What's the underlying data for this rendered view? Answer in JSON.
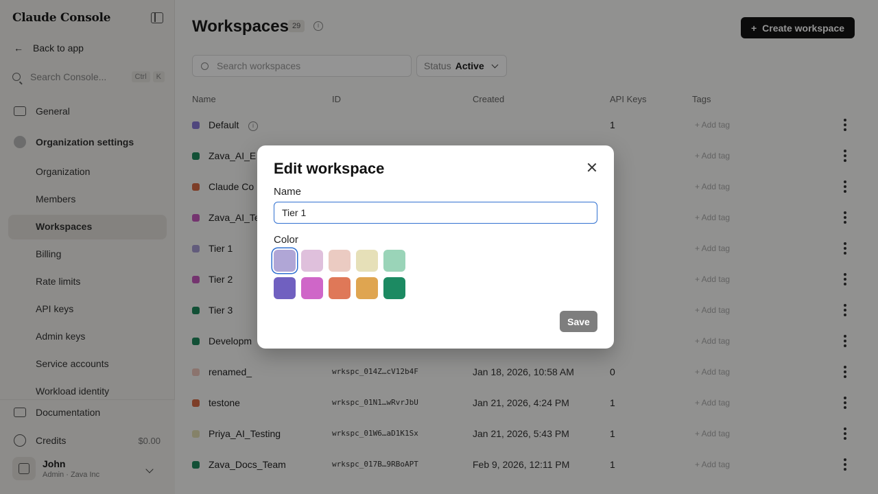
{
  "sidebar": {
    "logo": "Claude Console",
    "back": "Back to app",
    "search": {
      "placeholder": "Search Console...",
      "kbd1": "Ctrl",
      "kbd2": "K"
    },
    "general": "General",
    "org_settings": "Organization settings",
    "items": [
      "Organization",
      "Members",
      "Workspaces",
      "Billing",
      "Rate limits",
      "API keys",
      "Admin keys",
      "Service accounts",
      "Workload identity"
    ],
    "documentation": "Documentation",
    "credits": "Credits",
    "credits_value": "$0.00",
    "user": {
      "name": "John",
      "sub": "Admin · Zava Inc"
    }
  },
  "main": {
    "title": "Workspaces",
    "count": "29",
    "create_button": "Create workspace",
    "search_placeholder": "Search workspaces",
    "status_label": "Status",
    "status_value": "Active",
    "columns": [
      "Name",
      "ID",
      "Created",
      "API Keys",
      "Tags"
    ],
    "add_tag": "+ Add tag",
    "rows": [
      {
        "name": "Default",
        "id": "",
        "created": "",
        "keys": "1",
        "color": "#8a7ad8"
      },
      {
        "name": "Zava_AI_E",
        "id": "",
        "created": "",
        "keys": "",
        "color": "#1f8a5e"
      },
      {
        "name": "Claude Co",
        "id": "",
        "created": "",
        "keys": "",
        "color": "#d86b45"
      },
      {
        "name": "Zava_AI_Te",
        "id": "",
        "created": "",
        "keys": "",
        "color": "#c95bbf"
      },
      {
        "name": "Tier 1",
        "id": "",
        "created": "",
        "keys": "",
        "color": "#a99fd6"
      },
      {
        "name": "Tier 2",
        "id": "",
        "created": "",
        "keys": "",
        "color": "#c95bbf"
      },
      {
        "name": "Tier 3",
        "id": "",
        "created": "",
        "keys": "",
        "color": "#1f8a5e"
      },
      {
        "name": "Developm",
        "id": "",
        "created": "",
        "keys": "",
        "color": "#1f8a5e"
      },
      {
        "name": "renamed_",
        "id": "wrkspc_014Z…cV12b4F",
        "created": "Jan 18, 2026, 10:58 AM",
        "keys": "0",
        "color": "#f0c9bd"
      },
      {
        "name": "testone",
        "id": "wrkspc_01N1…wRvrJbU",
        "created": "Jan 21, 2026, 4:24 PM",
        "keys": "1",
        "color": "#d86b45"
      },
      {
        "name": "Priya_AI_Testing",
        "id": "wrkspc_01W6…aD1K1Sx",
        "created": "Jan 21, 2026, 5:43 PM",
        "keys": "1",
        "color": "#e5e0b6"
      },
      {
        "name": "Zava_Docs_Team",
        "id": "wrkspc_017B…9RBoAPT",
        "created": "Feb 9, 2026, 12:11 PM",
        "keys": "1",
        "color": "#1f8a5e"
      }
    ]
  },
  "modal": {
    "title": "Edit workspace",
    "name_label": "Name",
    "name_value": "Tier 1",
    "color_label": "Color",
    "colors": [
      "#b0a6d6",
      "#dfc0dc",
      "#ebcbc2",
      "#e6e0b8",
      "#9ad4b8",
      "#7060c0",
      "#cf66c8",
      "#df7858",
      "#dfa550",
      "#1c8a62"
    ],
    "selected_color_index": 0,
    "save_label": "Save"
  }
}
